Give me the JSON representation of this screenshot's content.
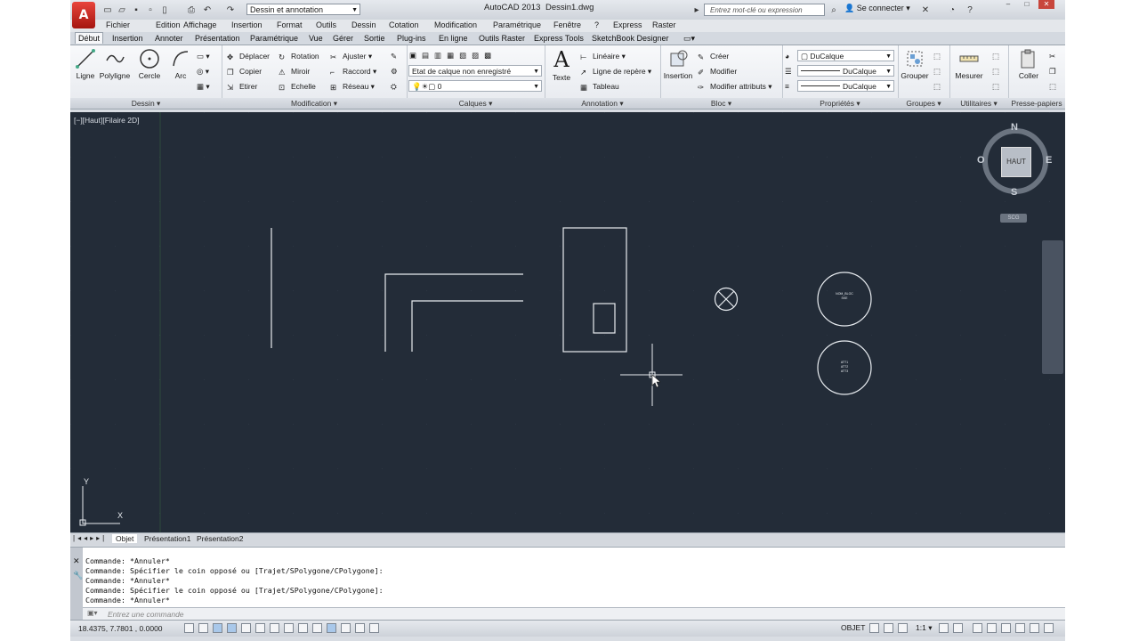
{
  "app": {
    "title": "AutoCAD 2013",
    "document": "Dessin1.dwg",
    "workspace": "Dessin et annotation",
    "search_placeholder": "Entrez mot-clé ou expression",
    "signin": "Se connecter",
    "logo": "A"
  },
  "menubar": [
    "Fichier",
    "Edition",
    "Affichage",
    "Insertion",
    "Format",
    "Outils",
    "Dessin",
    "Cotation",
    "Modification",
    "Paramétrique",
    "Fenêtre",
    "?",
    "Express",
    "Raster"
  ],
  "ribbon_tabs": [
    "Début",
    "Insertion",
    "Annoter",
    "Présentation",
    "Paramétrique",
    "Vue",
    "Gérer",
    "Sortie",
    "Plug-ins",
    "En ligne",
    "Outils Raster",
    "Express Tools",
    "SketchBook Designer"
  ],
  "ribbon": {
    "dessin": {
      "label": "Dessin",
      "tools": [
        "Ligne",
        "Polyligne",
        "Cercle",
        "Arc"
      ]
    },
    "modification": {
      "label": "Modification",
      "tools": [
        "Déplacer",
        "Rotation",
        "Ajuster",
        "Copier",
        "Miroir",
        "Raccord",
        "Etirer",
        "Echelle",
        "Réseau"
      ]
    },
    "calques": {
      "label": "Calques",
      "state": "Etat de calque non enregistré",
      "layer": "0"
    },
    "annotation": {
      "label": "Annotation",
      "texte": "Texte",
      "tools": [
        "Linéaire",
        "Ligne de repère",
        "Tableau"
      ]
    },
    "bloc": {
      "label": "Bloc",
      "insertion": "Insertion",
      "tools": [
        "Créer",
        "Modifier",
        "Modifier attributs"
      ]
    },
    "proprietes": {
      "label": "Propriétés",
      "color": "DuCalque",
      "linetype": "DuCalque",
      "lineweight": "DuCalque"
    },
    "groupes": {
      "label": "Groupes",
      "tool": "Grouper"
    },
    "utilitaires": {
      "label": "Utilitaires",
      "tool": "Mesurer"
    },
    "presse": {
      "label": "Presse-papiers",
      "tool": "Coller"
    }
  },
  "viewport": {
    "label": "[−][Haut][Filaire 2D]",
    "viewcube": {
      "n": "N",
      "s": "S",
      "e": "E",
      "w": "O",
      "face": "HAUT",
      "ucs": "SCG"
    },
    "block1_text": "NOM_BLOC\nSKE",
    "block2_text": "ATT1\nATT2\nATT3",
    "axis_x": "X",
    "axis_y": "Y"
  },
  "layout_tabs": [
    "Objet",
    "Présentation1",
    "Présentation2"
  ],
  "command": {
    "lines": [
      "Commande: *Annuler*",
      "Commande: Spécifier le coin opposé ou [Trajet/SPolygone/CPolygone]:",
      "Commande: *Annuler*",
      "Commande: Spécifier le coin opposé ou [Trajet/SPolygone/CPolygone]:",
      "Commande: *Annuler*"
    ],
    "placeholder": "Entrez une commande"
  },
  "status": {
    "coords": "18.4375, 7.7801 , 0.0000",
    "objet": "OBJET",
    "scale": "1:1"
  },
  "colors": {
    "drawing_bg": "#232c38",
    "geometry": "#e8ecf0"
  }
}
